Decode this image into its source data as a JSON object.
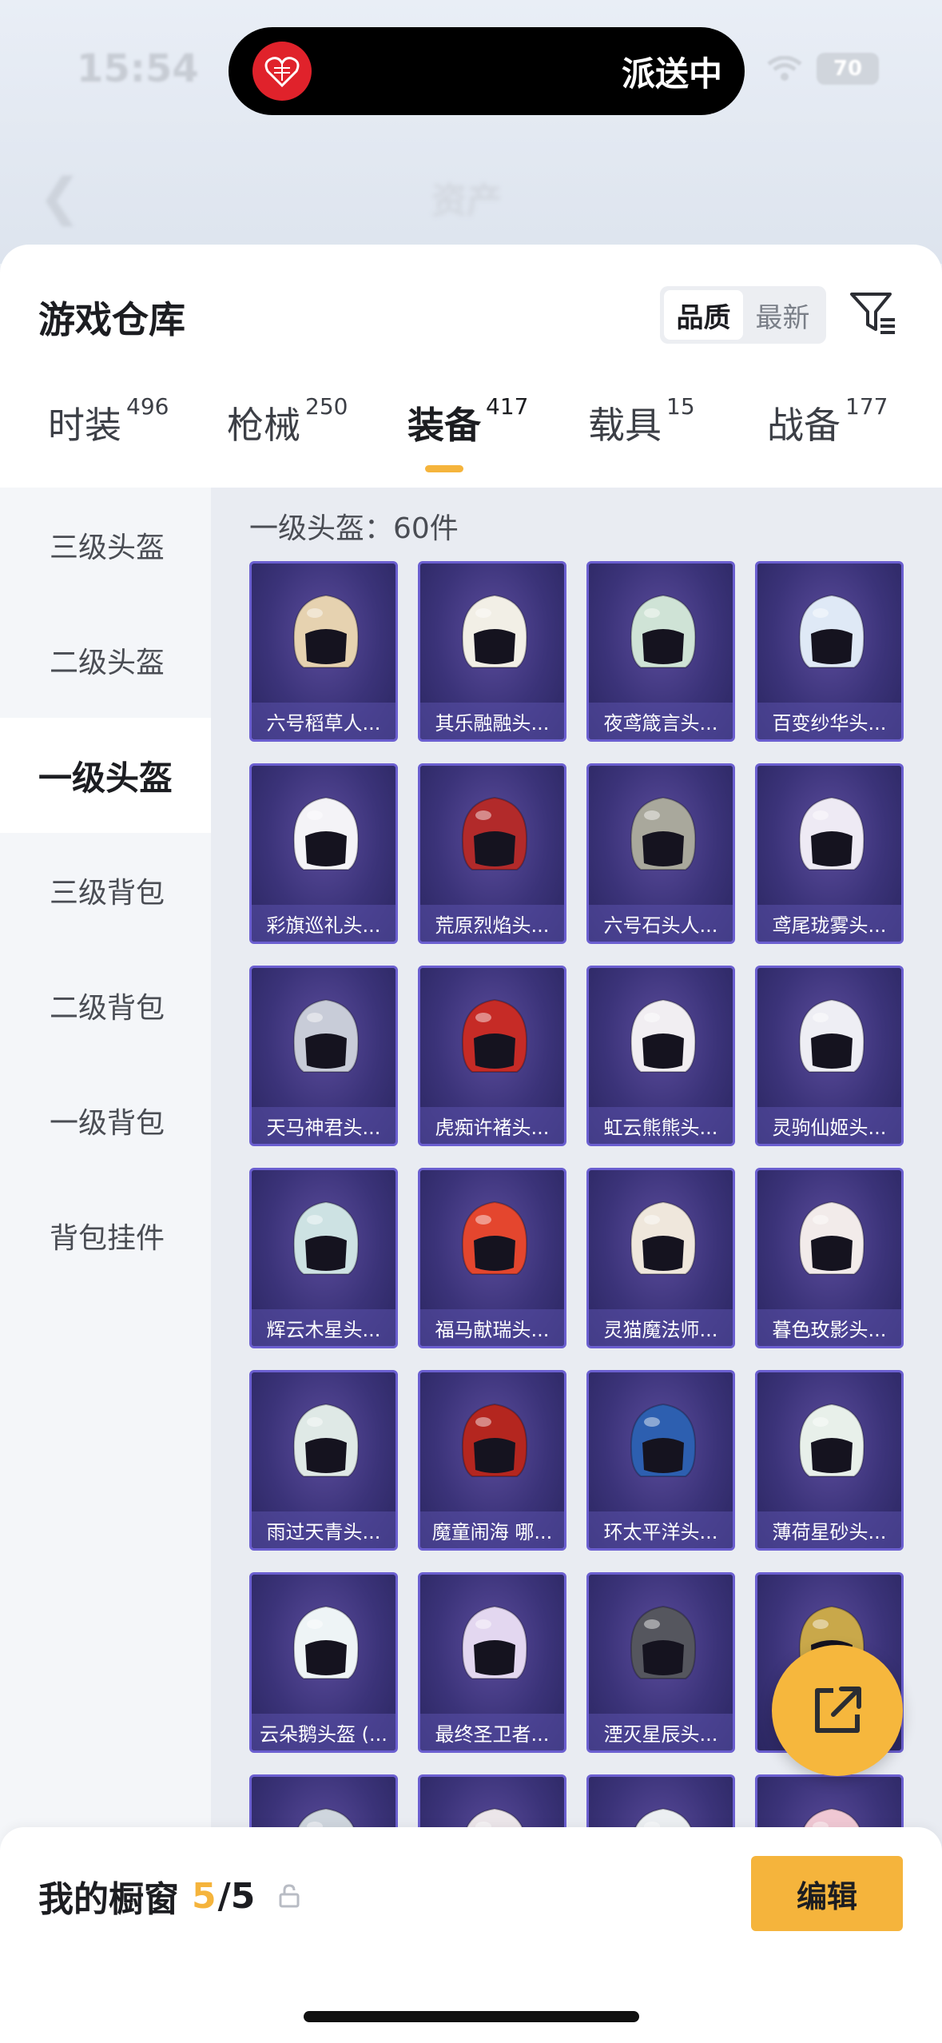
{
  "status": {
    "time": "15:54",
    "battery": "70"
  },
  "island": {
    "text": "派送中"
  },
  "header": {
    "title": "资产"
  },
  "sheet": {
    "title": "游戏仓库",
    "sort": [
      "品质",
      "最新"
    ]
  },
  "tabs": [
    {
      "label": "时装",
      "count": "496"
    },
    {
      "label": "枪械",
      "count": "250"
    },
    {
      "label": "装备",
      "count": "417"
    },
    {
      "label": "载具",
      "count": "15"
    },
    {
      "label": "战备",
      "count": "177"
    }
  ],
  "sidebar": [
    "三级头盔",
    "二级头盔",
    "一级头盔",
    "三级背包",
    "二级背包",
    "一级背包",
    "背包挂件"
  ],
  "section": {
    "label": "一级头盔：60件"
  },
  "items": [
    {
      "name": "六号稻草人...",
      "color": "#e6d2b0"
    },
    {
      "name": "其乐融融头...",
      "color": "#f2efe6"
    },
    {
      "name": "夜鸢箴言头...",
      "color": "#cfe3d6"
    },
    {
      "name": "百变纱华头...",
      "color": "#dfe9f6"
    },
    {
      "name": "彩旗巡礼头...",
      "color": "#f4f3f7"
    },
    {
      "name": "荒原烈焰头...",
      "color": "#b22a2a"
    },
    {
      "name": "六号石头人...",
      "color": "#a9a89c"
    },
    {
      "name": "鸢尾珑雾头...",
      "color": "#eeeaf4"
    },
    {
      "name": "天马神君头...",
      "color": "#c8ccd8"
    },
    {
      "name": "虎痴许褚头...",
      "color": "#c62b26"
    },
    {
      "name": "虹云熊熊头...",
      "color": "#f1eef2"
    },
    {
      "name": "灵驹仙姬头...",
      "color": "#eeeef4"
    },
    {
      "name": "辉云木星头...",
      "color": "#cde2e3"
    },
    {
      "name": "福马献瑞头...",
      "color": "#e4462e"
    },
    {
      "name": "灵猫魔法师...",
      "color": "#efe7dc"
    },
    {
      "name": "暮色玫影头...",
      "color": "#f2ebea"
    },
    {
      "name": "雨过天青头...",
      "color": "#dfe9e6"
    },
    {
      "name": "魔童闹海 哪...",
      "color": "#b4261f"
    },
    {
      "name": "环太平洋头...",
      "color": "#2d5fb0"
    },
    {
      "name": "薄荷星砂头...",
      "color": "#e8f0ea"
    },
    {
      "name": "云朵鹅头盔 (...",
      "color": "#eef4f6"
    },
    {
      "name": "最终圣卫者...",
      "color": "#e3d7f0"
    },
    {
      "name": "湮灭星辰头...",
      "color": "#55565e"
    },
    {
      "name": "",
      "color": "#c9a84a"
    },
    {
      "name": "",
      "color": "#cfd6de"
    },
    {
      "name": "",
      "color": "#ece6ea"
    },
    {
      "name": "",
      "color": "#eceff2"
    },
    {
      "name": "",
      "color": "#f0c8d4"
    }
  ],
  "bottom": {
    "title": "我的橱窗",
    "current": "5",
    "total": "/5",
    "edit_label": "编辑"
  }
}
